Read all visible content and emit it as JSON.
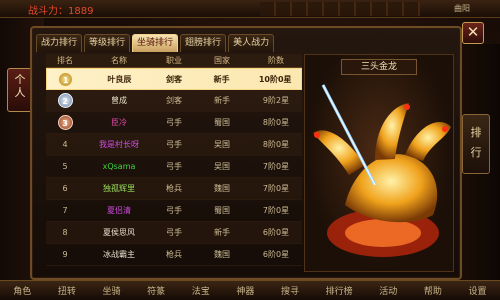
{
  "hud": {
    "power_text": "战斗力：1889",
    "top_right_label": "曲阳"
  },
  "left_tab": {
    "label": "个\n人"
  },
  "close_button": {
    "label": "✕"
  },
  "tabs": [
    {
      "label": "战力排行",
      "active": false
    },
    {
      "label": "等级排行",
      "active": false
    },
    {
      "label": "坐骑排行",
      "active": true
    },
    {
      "label": "翅膀排行",
      "active": false
    },
    {
      "label": "美人战力",
      "active": false
    }
  ],
  "table": {
    "headers": [
      "排名",
      "名称",
      "职业",
      "国家",
      "阶数"
    ],
    "rows": [
      {
        "rank": "1",
        "name": "叶良辰",
        "job": "剑客",
        "nation": "新手",
        "level": "10阶0星",
        "name_color": "#3b2208"
      },
      {
        "rank": "2",
        "name": "曾成",
        "job": "剑客",
        "nation": "新手",
        "level": "9阶2星",
        "name_color": "#e8e0cc"
      },
      {
        "rank": "3",
        "name": "臣冷",
        "job": "弓手",
        "nation": "蜀国",
        "level": "8阶0星",
        "name_color": "#e04aa8"
      },
      {
        "rank": "4",
        "name": "我是村长呀",
        "job": "弓手",
        "nation": "吴国",
        "level": "8阶0星",
        "name_color": "#d04ae0"
      },
      {
        "rank": "5",
        "name": "xQsama",
        "job": "弓手",
        "nation": "吴国",
        "level": "7阶0星",
        "name_color": "#3fd43f"
      },
      {
        "rank": "6",
        "name": "独孤辉里",
        "job": "枪兵",
        "nation": "魏国",
        "level": "7阶0星",
        "name_color": "#9be05a"
      },
      {
        "rank": "7",
        "name": "夏侣清",
        "job": "弓手",
        "nation": "蜀国",
        "level": "7阶0星",
        "name_color": "#d04ae0"
      },
      {
        "rank": "8",
        "name": "夏侯思风",
        "job": "弓手",
        "nation": "新手",
        "level": "6阶0星",
        "name_color": "#e8e0cc"
      },
      {
        "rank": "9",
        "name": "冰战霸主",
        "job": "枪兵",
        "nation": "魏国",
        "level": "6阶0星",
        "name_color": "#e8e0cc"
      }
    ]
  },
  "preview": {
    "title": "三头金龙"
  },
  "right_tab": {
    "label": "排\n行"
  },
  "bottom_nav": [
    "角色",
    "扭转",
    "坐骑",
    "符篆",
    "法宝",
    "神器",
    "搜寻",
    "排行榜",
    "活动",
    "帮助",
    "设置"
  ],
  "colors": {
    "accent_gold": "#f1d08a",
    "frame_brown": "#6d4b24",
    "power_red": "#e14a2a"
  }
}
